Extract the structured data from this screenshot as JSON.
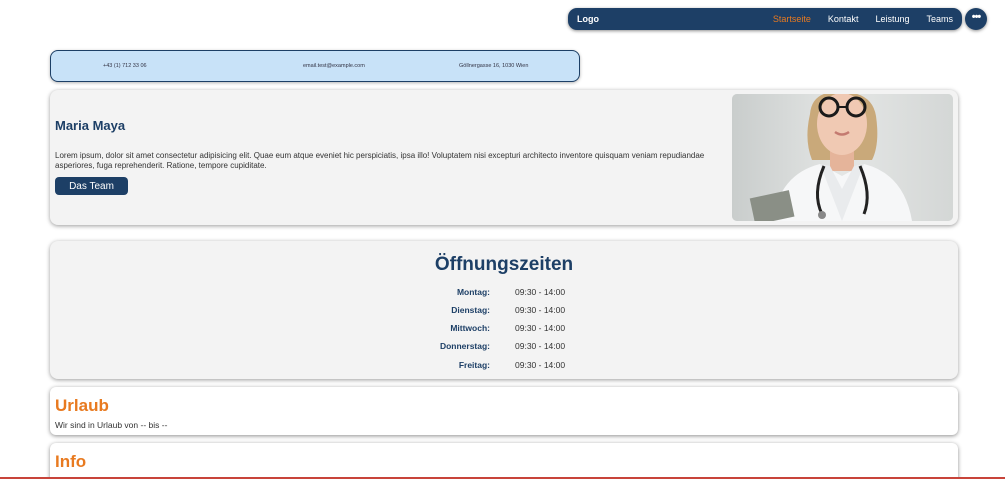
{
  "nav": {
    "logo": "Logo",
    "links": [
      "Startseite",
      "Kontakt",
      "Leistung",
      "Teams"
    ],
    "active_color": "#e87a20",
    "more_icon": "more-horizontal-icon"
  },
  "contact": {
    "phone": "+43 (1) 712 33 06",
    "email": "email.test@example.com",
    "address": "Göllnergasse 16, 1030 Wien"
  },
  "hero": {
    "name": "Maria Maya",
    "text": "Lorem ipsum, dolor sit amet consectetur adipisicing elit. Quae eum atque eveniet hic perspiciatis, ipsa illo! Voluptatem nisi excepturi architecto inventore quisquam veniam repudiandae asperiores, fuga reprehenderit. Ratione, tempore cupiditate.",
    "button": "Das Team"
  },
  "hours": {
    "title": "Öffnungszeiten",
    "rows": [
      {
        "day": "Montag:",
        "time": "09:30 - 14:00"
      },
      {
        "day": "Dienstag:",
        "time": "09:30 - 14:00"
      },
      {
        "day": "Mittwoch:",
        "time": "09:30 - 14:00"
      },
      {
        "day": "Donnerstag:",
        "time": "09:30 - 14:00"
      },
      {
        "day": "Freitag:",
        "time": "09:30 - 14:00"
      }
    ]
  },
  "vacation": {
    "title": "Urlaub",
    "text": "Wir sind in Urlaub von -- bis --"
  },
  "info": {
    "title": "Info"
  },
  "colors": {
    "primary": "#1d3f66",
    "accent": "#e87a20",
    "contact_bg": "#c8e2f8",
    "card_bg": "#f3f3f3"
  }
}
